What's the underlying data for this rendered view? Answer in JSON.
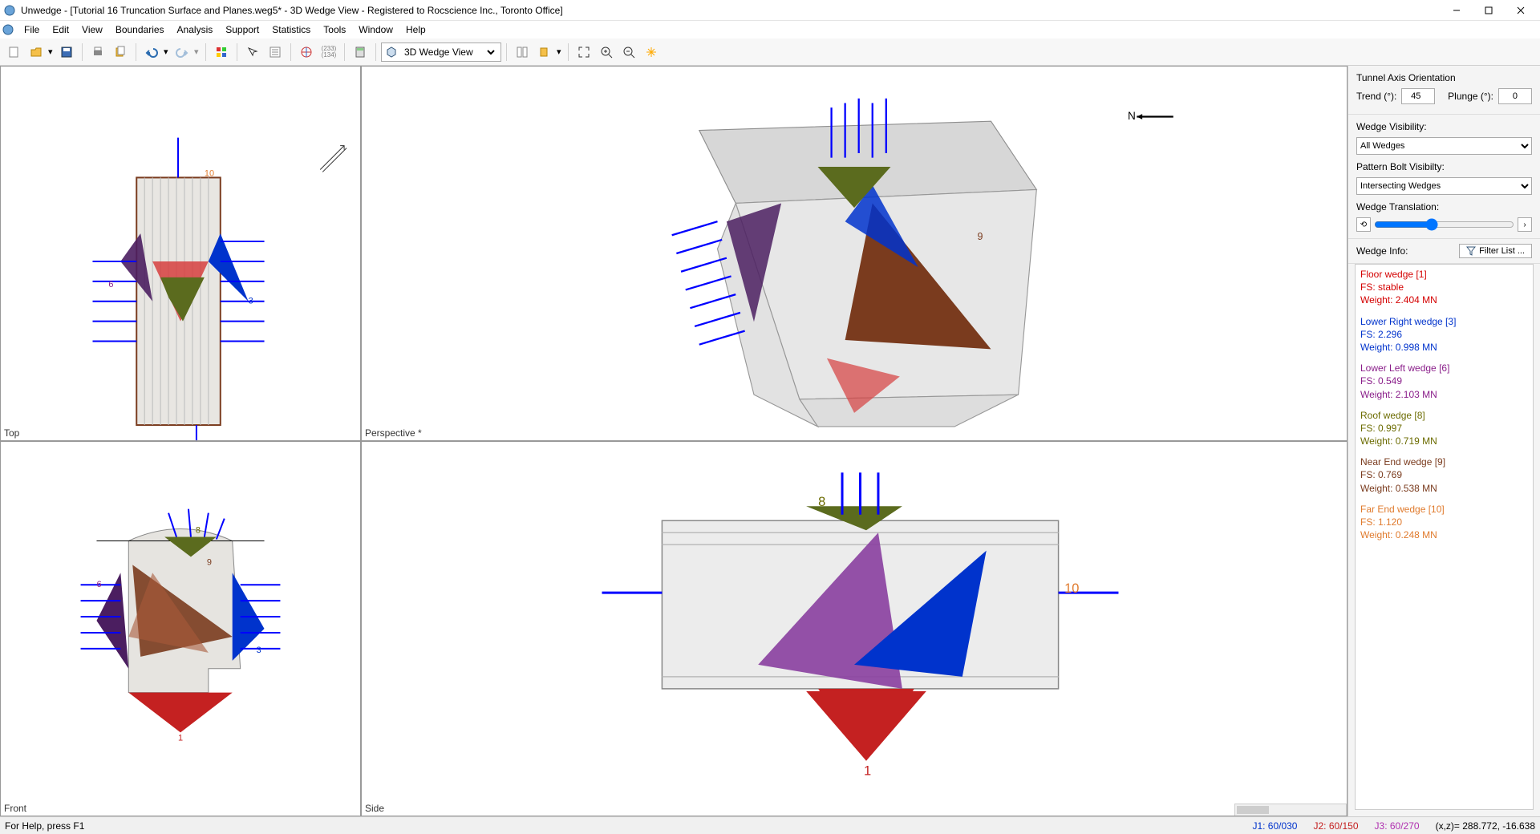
{
  "title": "Unwedge - [Tutorial 16 Truncation Surface and Planes.weg5* - 3D Wedge View - Registered to Rocscience Inc., Toronto Office]",
  "menu": [
    "File",
    "Edit",
    "View",
    "Boundaries",
    "Analysis",
    "Support",
    "Statistics",
    "Tools",
    "Window",
    "Help"
  ],
  "viewSelector": "3D Wedge View",
  "panes": {
    "tl": "Top",
    "tr": "Perspective *",
    "bl": "Front",
    "br": "Side"
  },
  "side": {
    "axisTitle": "Tunnel Axis Orientation",
    "trendLabel": "Trend (°):",
    "trend": 45,
    "plungeLabel": "Plunge (°):",
    "plunge": 0,
    "wvTitle": "Wedge Visibility:",
    "wvValue": "All Wedges",
    "pbTitle": "Pattern Bolt Visibilty:",
    "pbValue": "Intersecting Wedges",
    "wtTitle": "Wedge Translation:",
    "wiTitle": "Wedge Info:",
    "filterBtn": "Filter List ..."
  },
  "wedges": [
    {
      "color": "#d40000",
      "name": "Floor wedge [1]",
      "fs": "FS: stable",
      "wt": "Weight: 2.404 MN"
    },
    {
      "color": "#0033cc",
      "name": "Lower Right wedge [3]",
      "fs": "FS: 2.296",
      "wt": "Weight: 0.998 MN"
    },
    {
      "color": "#8a1e8a",
      "name": "Lower Left wedge [6]",
      "fs": "FS: 0.549",
      "wt": "Weight: 2.103 MN"
    },
    {
      "color": "#6b6b00",
      "name": "Roof wedge [8]",
      "fs": "FS: 0.997",
      "wt": "Weight: 0.719 MN"
    },
    {
      "color": "#7a3b1e",
      "name": "Near End wedge [9]",
      "fs": "FS: 0.769",
      "wt": "Weight: 0.538 MN"
    },
    {
      "color": "#e07b2e",
      "name": "Far End wedge [10]",
      "fs": "FS: 1.120",
      "wt": "Weight: 0.248 MN"
    }
  ],
  "status": {
    "help": "For Help, press F1",
    "j1": "J1: 60/030",
    "j2": "J2: 60/150",
    "j3": "J3: 60/270",
    "coords": "(x,z)= 288.772, -16.638"
  },
  "labels": {
    "topNum10": "10",
    "topNum6": "6",
    "topNum3": "3",
    "frNum8": "8",
    "frNum9": "9",
    "frNum6": "6",
    "frNum3": "3",
    "frNum1": "1",
    "sdNum8": "8",
    "sdNum1": "1",
    "sdNum10": "10",
    "persp9": "9",
    "perspN": "N"
  }
}
